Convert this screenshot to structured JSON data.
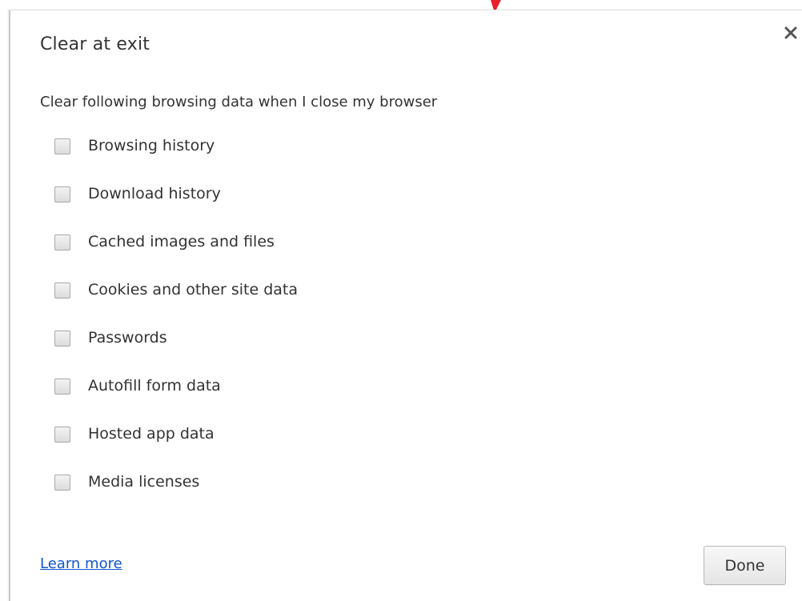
{
  "dialog": {
    "title": "Clear at exit",
    "subtitle": "Clear following browsing data when I close my browser",
    "close_icon": "close-icon",
    "options": [
      {
        "label": "Browsing history",
        "checked": false
      },
      {
        "label": "Download history",
        "checked": false
      },
      {
        "label": "Cached images and files",
        "checked": false
      },
      {
        "label": "Cookies and other site data",
        "checked": false
      },
      {
        "label": "Passwords",
        "checked": false
      },
      {
        "label": "Autofill form data",
        "checked": false
      },
      {
        "label": "Hosted app data",
        "checked": false
      },
      {
        "label": "Media licenses",
        "checked": false
      }
    ],
    "learn_more": "Learn more",
    "done_label": "Done"
  },
  "colors": {
    "link": "#1155cc",
    "text": "#333333",
    "pointer_arrow": "#e8202a"
  }
}
